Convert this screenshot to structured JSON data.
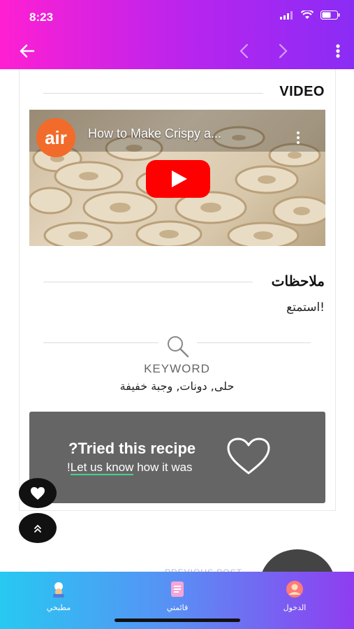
{
  "status_bar": {
    "time": "8:23"
  },
  "video_section": {
    "title": "VIDEO",
    "video_title": "How to Make Crispy a...",
    "channel_logo_text": "air"
  },
  "notes_section": {
    "title": "ملاحظات",
    "text": "استمتع!"
  },
  "keyword_section": {
    "label": "KEYWORD",
    "value": "حلى, دونات, وجبة خفيفة"
  },
  "tried_box": {
    "title": "?Tried this recipe",
    "link_text": "Let us know",
    "prefix": "!",
    "suffix": " how it was"
  },
  "previous_post_label": "PREVIOUS POST",
  "bottom_nav": {
    "tabs": [
      {
        "label": "مطبخي",
        "icon": "chef-icon"
      },
      {
        "label": "قائمتي",
        "icon": "list-icon"
      },
      {
        "label": "الدخول",
        "icon": "login-icon"
      }
    ]
  },
  "colors": {
    "header_gradient_start": "#ff1fd2",
    "header_gradient_end": "#8a2cf5",
    "bottom_nav_start": "#27c9f2",
    "bottom_nav_end": "#8f3df0",
    "tried_box_bg": "#656565",
    "play_button": "#ff0000",
    "link_underline": "#4ad08f"
  }
}
